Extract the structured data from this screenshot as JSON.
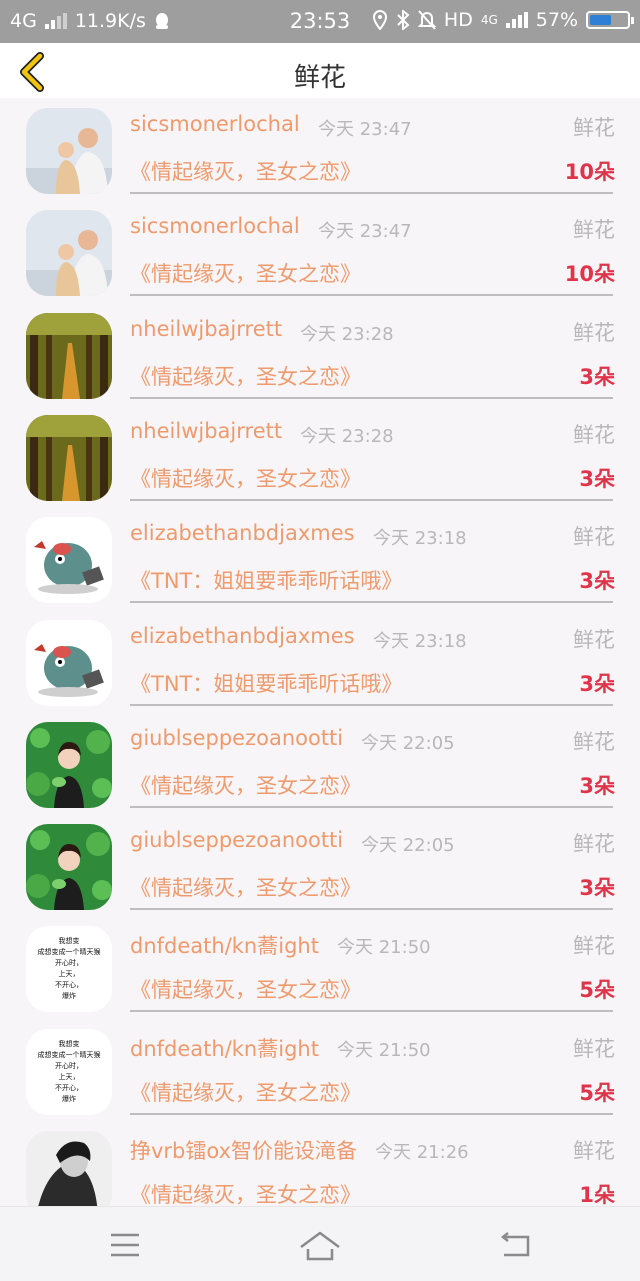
{
  "status_bar": {
    "network": "4G",
    "speed": "11.9K/s",
    "time": "23:53",
    "hd": "HD",
    "net4g": "4G",
    "battery": "57%",
    "battery_level": 0.57
  },
  "header": {
    "title": "鲜花"
  },
  "colors": {
    "accent": "#ef9a6c",
    "count": "#e0344b",
    "back": "#f1c40f"
  },
  "gift_rows": [
    {
      "user": "sicsmonerlochal",
      "time": "今天 23:47",
      "gift": "鲜花",
      "book": "《情起缘灭，圣女之恋》",
      "count": "10朵",
      "avatar": "parent-child-photo"
    },
    {
      "user": "sicsmonerlochal",
      "time": "今天 23:47",
      "gift": "鲜花",
      "book": "《情起缘灭，圣女之恋》",
      "count": "10朵",
      "avatar": "parent-child-photo"
    },
    {
      "user": "nheilwjbajrrett",
      "time": "今天 23:28",
      "gift": "鲜花",
      "book": "《情起缘灭，圣女之恋》",
      "count": "3朵",
      "avatar": "forest-path-photo"
    },
    {
      "user": "nheilwjbajrrett",
      "time": "今天 23:28",
      "gift": "鲜花",
      "book": "《情起缘灭，圣女之恋》",
      "count": "3朵",
      "avatar": "forest-path-photo"
    },
    {
      "user": "elizabethanbdjaxmes",
      "time": "今天 23:18",
      "gift": "鲜花",
      "book": "《TNT：姐姐要乖乖听话哦》",
      "count": "3朵",
      "avatar": "cartoon-dino"
    },
    {
      "user": "elizabethanbdjaxmes",
      "time": "今天 23:18",
      "gift": "鲜花",
      "book": "《TNT：姐姐要乖乖听话哦》",
      "count": "3朵",
      "avatar": "cartoon-dino"
    },
    {
      "user": "giublseppezoanootti",
      "time": "今天 22:05",
      "gift": "鲜花",
      "book": "《情起缘灭，圣女之恋》",
      "count": "3朵",
      "avatar": "girl-green-leaves"
    },
    {
      "user": "giublseppezoanootti",
      "time": "今天 22:05",
      "gift": "鲜花",
      "book": "《情起缘灭，圣女之恋》",
      "count": "3朵",
      "avatar": "girl-green-leaves"
    },
    {
      "user": "dnfdeath/kn蕎ight",
      "time": "今天 21:50",
      "gift": "鲜花",
      "book": "《情起缘灭，圣女之恋》",
      "count": "5朵",
      "avatar": "text-image",
      "avatar_text": [
        "我想变",
        "成想变成一个晴天猴",
        "开心时，",
        "上天，",
        "不开心，",
        "爆炸"
      ]
    },
    {
      "user": "dnfdeath/kn蕎ight",
      "time": "今天 21:50",
      "gift": "鲜花",
      "book": "《情起缘灭，圣女之恋》",
      "count": "5朵",
      "avatar": "text-image",
      "avatar_text": [
        "我想变",
        "成想变成一个晴天猴",
        "开心时，",
        "上天，",
        "不开心，",
        "爆炸"
      ]
    },
    {
      "user": "挣vrb镭ox智价能设滝备",
      "time": "今天 21:26",
      "gift": "鲜花",
      "book": "《情起缘灭，圣女之恋》",
      "count": "1朵",
      "avatar": "bw-portrait"
    }
  ]
}
